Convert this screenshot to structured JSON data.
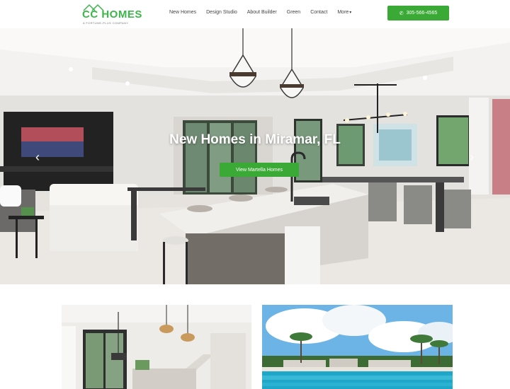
{
  "header": {
    "logo_text": "CC HOMES",
    "logo_tagline": "A FORTUNE-PLUS COMPANY",
    "nav": [
      "New Homes",
      "Design Studio",
      "About Builder",
      "Green",
      "Contact",
      "More"
    ],
    "phone": "305-566-4565"
  },
  "hero": {
    "title": "New Homes in Miramar, FL",
    "cta_label": "View Martella Homes"
  },
  "colors": {
    "brand_green": "#3aa935",
    "logo_green": "#3cb54a"
  },
  "icons": [
    "phone-icon",
    "chevron-down-icon",
    "arrow-left-icon",
    "arrow-right-icon"
  ]
}
